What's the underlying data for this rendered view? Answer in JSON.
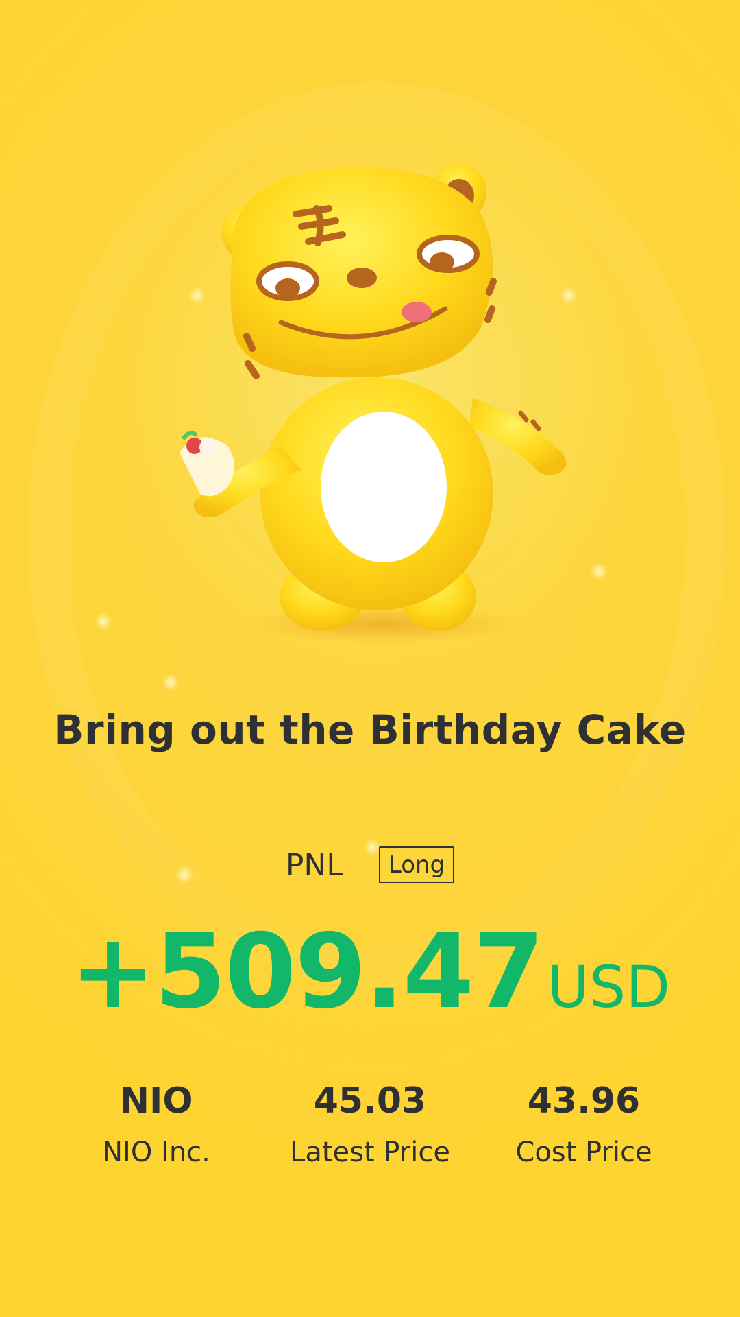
{
  "card": {
    "headline": "Bring out the Birthday Cake",
    "pnl_label": "PNL",
    "side_badge": "Long",
    "pnl_amount": "+509.47",
    "pnl_unit": "USD",
    "pnl_color": "#12b76a",
    "background_color": "#fdd53a",
    "mascot_icon": "tiger-mascot-icon"
  },
  "stats": [
    {
      "value": "NIO",
      "label": "NIO Inc."
    },
    {
      "value": "45.03",
      "label": "Latest Price"
    },
    {
      "value": "43.96",
      "label": "Cost Price"
    }
  ]
}
